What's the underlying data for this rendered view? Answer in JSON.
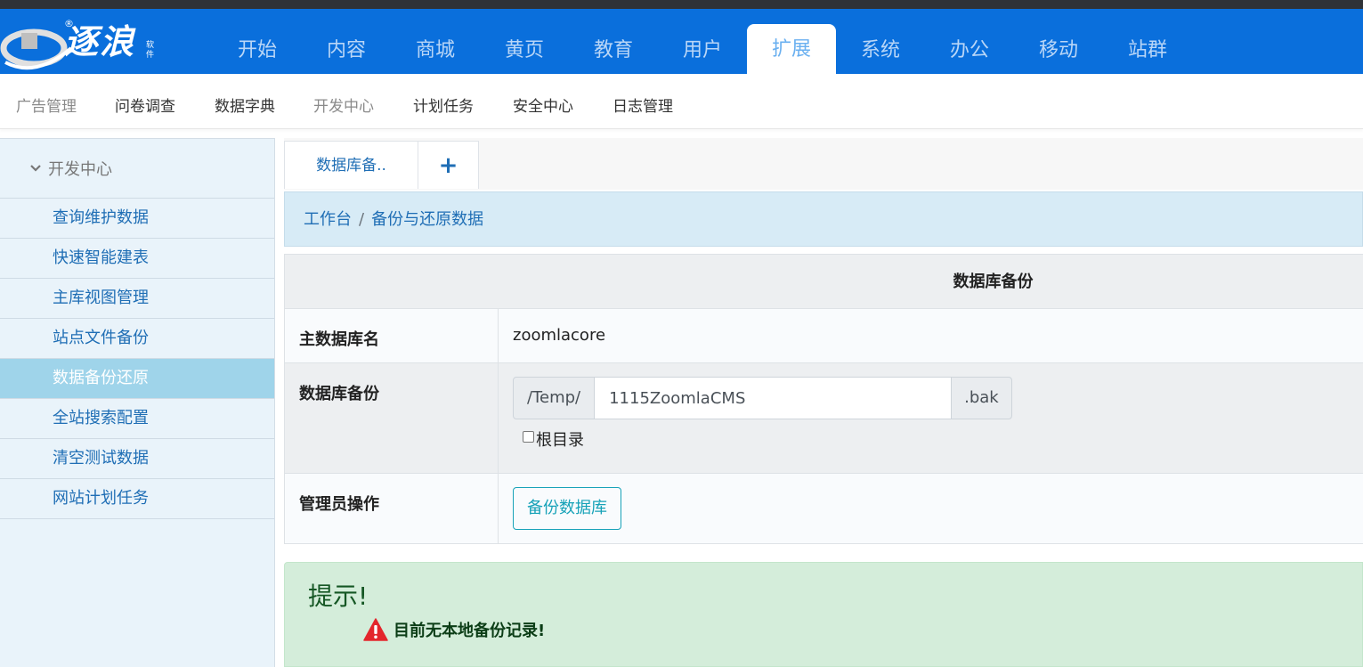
{
  "brand": {
    "name": "逐浪",
    "sub": "软件",
    "reg": "®"
  },
  "topnav": {
    "items": [
      "开始",
      "内容",
      "商城",
      "黄页",
      "教育",
      "用户",
      "扩展",
      "系统",
      "办公",
      "移动",
      "站群"
    ],
    "active": "扩展"
  },
  "subnav": {
    "items": [
      "广告管理",
      "问卷调查",
      "数据字典",
      "开发中心",
      "计划任务",
      "安全中心",
      "日志管理"
    ]
  },
  "sidebar": {
    "section": "开发中心",
    "items": [
      "查询维护数据",
      "快速智能建表",
      "主库视图管理",
      "站点文件备份",
      "数据备份还原",
      "全站搜索配置",
      "清空测试数据",
      "网站计划任务"
    ],
    "active": "数据备份还原"
  },
  "tabs": {
    "current": "数据库备..",
    "add": "+"
  },
  "breadcrumb": {
    "home": "工作台",
    "sep": "/",
    "current": "备份与还原数据"
  },
  "table": {
    "title": "数据库备份",
    "db_name_label": "主数据库名",
    "db_name_value": "zoomlacore",
    "backup_label": "数据库备份",
    "path_prefix": "/Temp/",
    "file_name": "1115ZoomlaCMS",
    "ext": ".bak",
    "root_dir_label": "根目录",
    "root_dir_checked": false,
    "admin_label": "管理员操作",
    "backup_button": "备份数据库"
  },
  "alert": {
    "title": "提示!",
    "message": "目前无本地备份记录!"
  },
  "colors": {
    "nav": "#0a6fdc",
    "accent": "#1f6eb5",
    "info": "#17a2b8",
    "success_bg": "#d4edda",
    "danger": "#e3262c"
  },
  "icons": [
    "brand-logo",
    "chevron-down-icon",
    "warning-icon"
  ]
}
